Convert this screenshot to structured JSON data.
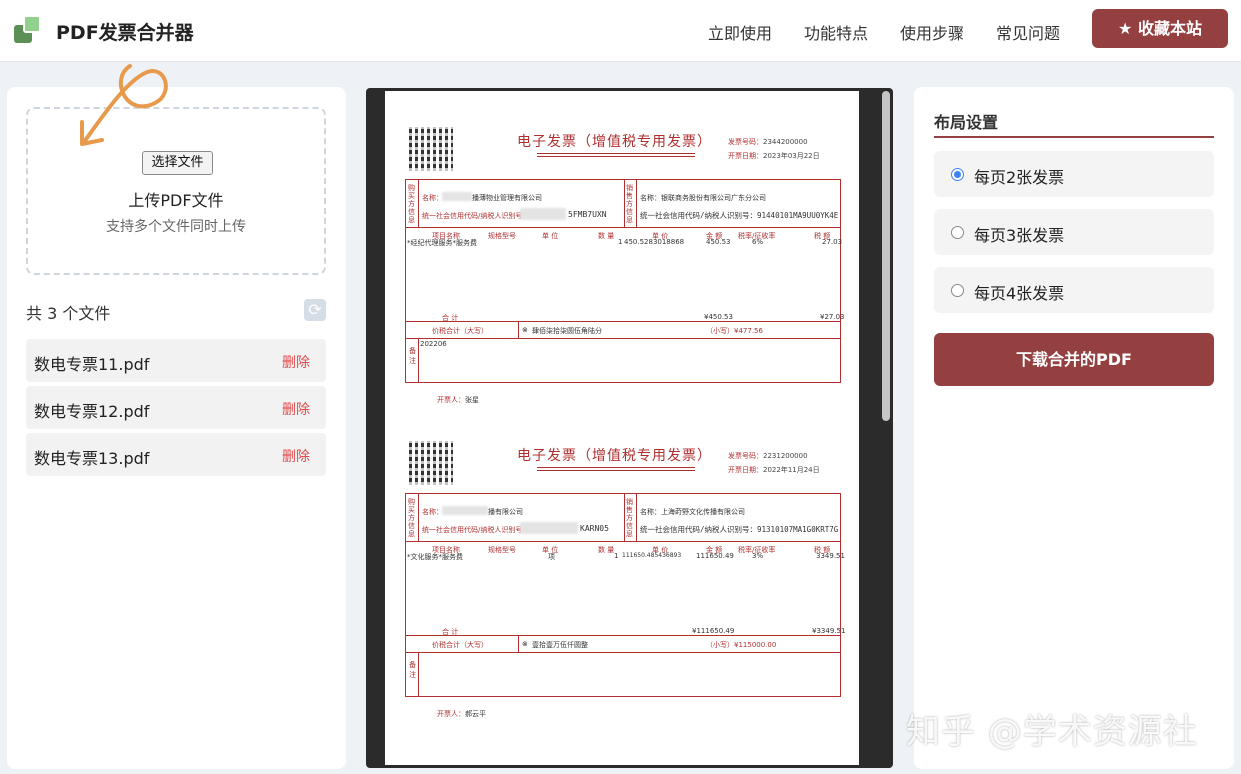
{
  "header": {
    "brand": "PDF发票合并器",
    "nav": [
      "立即使用",
      "功能特点",
      "使用步骤",
      "常见问题"
    ],
    "favorite_label": "★ 收藏本站"
  },
  "upload": {
    "choose_label": "选择文件",
    "title": "上传PDF文件",
    "subtitle": "支持多个文件同时上传"
  },
  "files": {
    "count_label": "共 3 个文件",
    "delete_label": "删除",
    "items": [
      "数电专票11.pdf",
      "数电专票12.pdf",
      "数电专票13.pdf"
    ]
  },
  "preview": {
    "invoices": [
      {
        "title": "电子发票（增值税专用发票）",
        "number_label": "发票号码：",
        "number": "2344200000",
        "date_label": "开票日期：",
        "date": "2023年03月22日",
        "buyer_name": "名称：",
        "buyer_name_value": "播薄物业管理有限公司",
        "buyer_tax_label": "统一社会信用代码/纳税人识别号：",
        "buyer_tax": "5FMB7UXN",
        "seller_name_value": "名称：银联商务股份有限公司广东分公司",
        "seller_tax": "统一社会信用代码/纳税人识别号：91440101MA9UU0YK4E",
        "item": "*经纪代理服务*服务费",
        "qty": "1",
        "price": "450.5283018868",
        "amount": "450.53",
        "rate": "6%",
        "tax": "27.03",
        "sum_amount": "¥450.53",
        "sum_tax": "¥27.03",
        "total_words": "肆佰柒拾柒圆伍角陆分",
        "total_num": "（小写）¥477.56",
        "remark": "202206",
        "issuer_label": "开票人：",
        "issuer": "张星"
      },
      {
        "title": "电子发票（增值税专用发票）",
        "number_label": "发票号码：",
        "number": "2231200000",
        "date_label": "开票日期：",
        "date": "2022年11月24日",
        "buyer_name": "名称：",
        "buyer_name_value": "播有限公司",
        "buyer_tax_label": "统一社会信用代码/纳税人识别号：",
        "buyer_tax": "KARN05",
        "seller_name_value": "名称：上海莳野文化传播有限公司",
        "seller_tax": "统一社会信用代码/纳税人识别号：91310107MA1G0KRT7G",
        "item": "*文化服务*服务费",
        "unit": "项",
        "qty": "1",
        "price": "111650.485436893",
        "amount": "111650.49",
        "rate": "3%",
        "tax": "3349.51",
        "sum_amount": "¥111650.49",
        "sum_tax": "¥3349.51",
        "total_words": "壹拾壹万伍仟圆整",
        "total_num": "（小写）¥115000.00",
        "remark": "",
        "issuer_label": "开票人：",
        "issuer": "郝云平"
      }
    ],
    "labels": {
      "buyer_side": "购买方信息",
      "seller_side": "销售方信息",
      "col_item": "项目名称",
      "col_spec": "规格型号",
      "col_unit": "单 位",
      "col_qty": "数 量",
      "col_price": "单 价",
      "col_amount": "金 额",
      "col_rate": "税率/征收率",
      "col_tax": "税 额",
      "sum": "合 计",
      "total": "价税合计（大写）",
      "remark": "备注"
    }
  },
  "layout_settings": {
    "title": "布局设置",
    "options": [
      "每页2张发票",
      "每页3张发票",
      "每页4张发票"
    ],
    "selected_index": 0,
    "download_label": "下载合并的PDF"
  },
  "watermark": "知乎 @学术资源社",
  "colors": {
    "accent": "#944040",
    "invoice_red": "#b03030",
    "radio_blue": "#3b82f6",
    "logo_green": "#8fd08a",
    "delete_red": "#e04a4a"
  }
}
